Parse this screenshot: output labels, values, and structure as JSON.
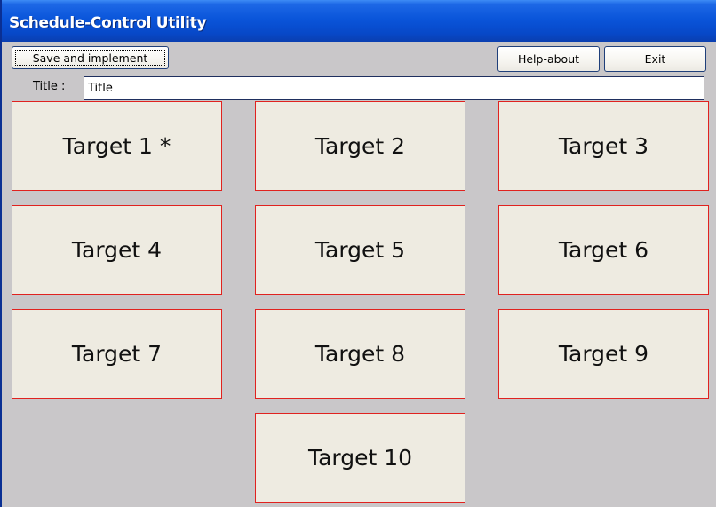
{
  "window": {
    "title": "Schedule-Control Utility"
  },
  "toolbar": {
    "save_label": "Save and implement",
    "help_label": "Help-about",
    "exit_label": "Exit"
  },
  "title_field": {
    "label": "Title :",
    "value": "Title"
  },
  "targets": [
    {
      "label": "Target 1 *"
    },
    {
      "label": "Target 2"
    },
    {
      "label": "Target 3"
    },
    {
      "label": "Target 4"
    },
    {
      "label": "Target 5"
    },
    {
      "label": "Target 6"
    },
    {
      "label": "Target 7"
    },
    {
      "label": "Target 8"
    },
    {
      "label": "Target 9"
    },
    {
      "label": "Target 10"
    }
  ],
  "colors": {
    "titlebar": "#0a55da",
    "window_background": "#c9c7c9",
    "target_fill": "#eeebe1",
    "target_border": "#e0221f"
  }
}
